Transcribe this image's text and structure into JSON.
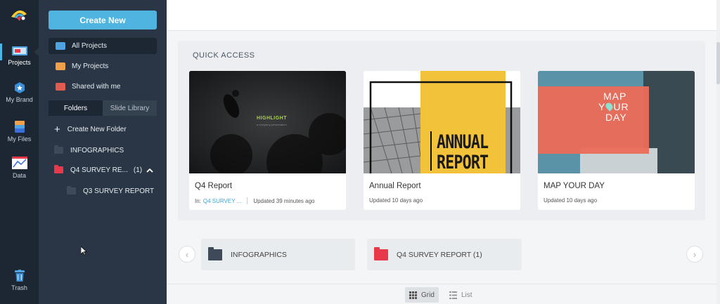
{
  "rail": {
    "items": [
      {
        "label": "Projects",
        "icon": "projects-icon"
      },
      {
        "label": "My Brand",
        "icon": "brand-icon"
      },
      {
        "label": "My Files",
        "icon": "files-icon"
      },
      {
        "label": "Data",
        "icon": "data-icon"
      },
      {
        "label": "Trash",
        "icon": "trash-icon"
      }
    ]
  },
  "sidebar": {
    "create_label": "Create New",
    "nav": [
      {
        "label": "All Projects",
        "color": "#4fa3e0"
      },
      {
        "label": "My Projects",
        "color": "#f0a04b"
      },
      {
        "label": "Shared with me",
        "color": "#e25b4f"
      }
    ],
    "tabs": {
      "folders": "Folders",
      "slide_library": "Slide Library"
    },
    "create_folder_label": "Create New Folder",
    "folders": [
      {
        "label": "INFOGRAPHICS",
        "color": "#3e4a59"
      },
      {
        "label": "Q4 SURVEY RE...",
        "count": "(1)",
        "color": "#e8394a"
      },
      {
        "label": "Q3 SURVEY REPORT",
        "color": "#3e4a59"
      }
    ]
  },
  "main": {
    "quick_access_title": "QUICK ACCESS",
    "cards": [
      {
        "title": "Q4 Report",
        "in_label": "In:",
        "in_folder": "Q4 SURVEY ...",
        "updated": "Updated 39 minutes ago",
        "thumb": {
          "heading": "HIGHLIGHT",
          "sub": "a company presentation"
        }
      },
      {
        "title": "Annual Report",
        "updated": "Updated 10 days ago",
        "thumb": {
          "line1": "ANNUAL",
          "line2": "REPORT"
        }
      },
      {
        "title": "MAP YOUR DAY",
        "updated": "Updated 10 days ago",
        "thumb": {
          "line1": "MAP",
          "line2a": "Y",
          "line2b": "UR",
          "line3": "DAY"
        }
      }
    ],
    "folder_cards": [
      {
        "label": "INFOGRAPHICS",
        "color": "#3e4a59"
      },
      {
        "label": "Q4 SURVEY REPORT (1)",
        "color": "#e8394a"
      }
    ],
    "prev_glyph": "‹",
    "next_glyph": "›",
    "view": {
      "grid": "Grid",
      "list": "List"
    }
  },
  "colors": {
    "accent": "#4fb5e0",
    "rail_bg": "#1d2733",
    "sidebar_bg": "#2a3645"
  }
}
